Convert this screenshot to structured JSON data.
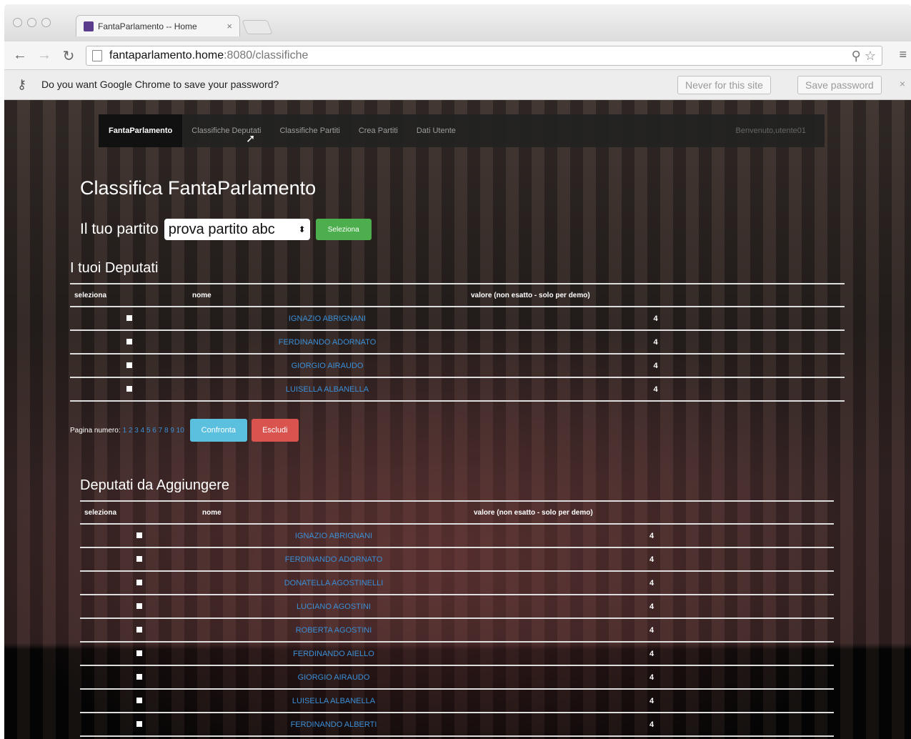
{
  "browser": {
    "tab_title": "FantaParlamento -- Home",
    "tab_close": "×",
    "url_host": "fantaparlamento.home",
    "url_rest": ":8080/classifiche",
    "password_prompt": "Do you want Google Chrome to save your password?",
    "never_button": "Never for this site",
    "save_button": "Save password"
  },
  "navbar": {
    "brand": "FantaParlamento",
    "items": [
      "Classifiche Deputati",
      "Classifiche Partiti",
      "Crea Partiti",
      "Dati Utente"
    ],
    "welcome": "Benvenuto,utente01"
  },
  "page": {
    "title": "Classifica FantaParlamento",
    "party_label": "Il tuo partito",
    "party_selected": "prova partito abc",
    "select_button": "Seleziona",
    "my_deputies_title": "I tuoi Deputati",
    "add_deputies_title": "Deputati da Aggiungere",
    "pager_label": "Pagina numero:",
    "pager_pages": "1 2 3 4 5 6 7 8 9 10",
    "compare_button": "Confronta",
    "exclude_button": "Escludi"
  },
  "table_headers": [
    "seleziona",
    "nome",
    "valore (non esatto - solo per demo)"
  ],
  "my_deputies": [
    {
      "nome": "IGNAZIO ABRIGNANI",
      "valore": "4"
    },
    {
      "nome": "FERDINANDO ADORNATO",
      "valore": "4"
    },
    {
      "nome": "GIORGIO AIRAUDO",
      "valore": "4"
    },
    {
      "nome": "LUISELLA ALBANELLA",
      "valore": "4"
    }
  ],
  "add_deputies": [
    {
      "nome": "IGNAZIO ABRIGNANI",
      "valore": "4"
    },
    {
      "nome": "FERDINANDO ADORNATO",
      "valore": "4"
    },
    {
      "nome": "DONATELLA AGOSTINELLI",
      "valore": "4"
    },
    {
      "nome": "LUCIANO AGOSTINI",
      "valore": "4"
    },
    {
      "nome": "ROBERTA AGOSTINI",
      "valore": "4"
    },
    {
      "nome": "FERDINANDO AIELLO",
      "valore": "4"
    },
    {
      "nome": "GIORGIO AIRAUDO",
      "valore": "4"
    },
    {
      "nome": "LUISELLA ALBANELLA",
      "valore": "4"
    },
    {
      "nome": "FERDINANDO ALBERTI",
      "valore": "4"
    }
  ],
  "colors": {
    "accent_link": "#3b8fd6",
    "success": "#4cae4c",
    "info": "#5bc0de",
    "danger": "#d9534f"
  }
}
